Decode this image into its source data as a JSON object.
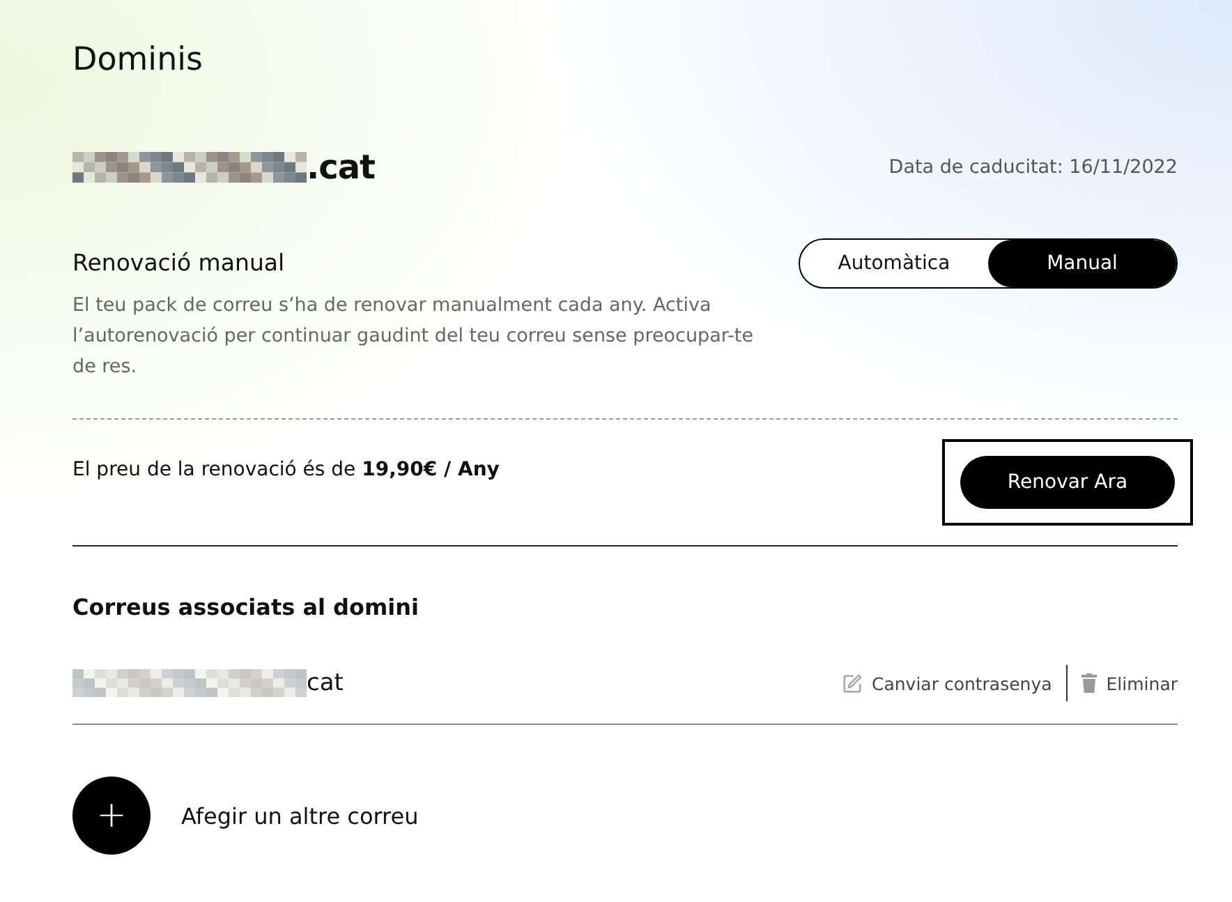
{
  "page_title": "Dominis",
  "domain": {
    "name_suffix": ".cat",
    "expiry": "Data de caducitat: 16/11/2022"
  },
  "renewal": {
    "title": "Renovació manual",
    "description": "El teu pack de correu s’ha de renovar manualment cada any. Activa l’autorenovació per continuar gaudint del teu correu sense preocupar-te de res.",
    "options": [
      {
        "label": "Automàtica",
        "selected": false
      },
      {
        "label": "Manual",
        "selected": true
      }
    ],
    "price_text": "El preu de la renovació és de **19,90€ / Any**",
    "button": "Renovar Ara",
    "button_highlighted": true
  },
  "emails": {
    "title": "Correus associats al domini",
    "items": [
      {
        "address_suffix": "cat",
        "actions": [
          "Canviar contrasenya",
          "Eliminar"
        ]
      }
    ],
    "add_label": "Afegir un altre correu",
    "add_icon": "+"
  }
}
